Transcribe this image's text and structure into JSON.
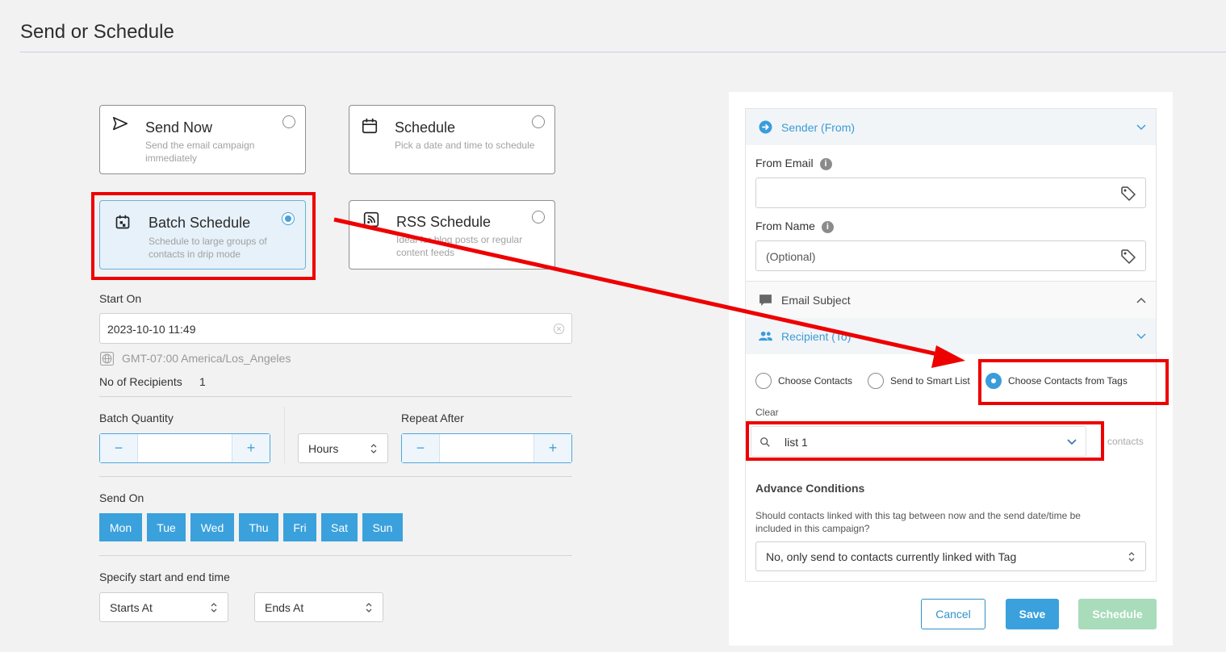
{
  "page": {
    "title": "Send or Schedule"
  },
  "options": [
    {
      "title": "Send Now",
      "subtitle_lines": [
        "Send the email campaign",
        "immediately"
      ],
      "icon": "paper-plane-icon",
      "selected": false
    },
    {
      "title": "Schedule",
      "subtitle_lines": [
        "Pick a date and time to schedule"
      ],
      "icon": "calendar-icon",
      "selected": false
    },
    {
      "title": "Batch Schedule",
      "subtitle_lines": [
        "Schedule to large groups of",
        "contacts in drip mode"
      ],
      "icon": "batch-calendar-icon",
      "selected": true
    },
    {
      "title": "RSS Schedule",
      "subtitle_lines": [
        "Ideal for blog posts or regular",
        "content feeds"
      ],
      "icon": "rss-icon",
      "selected": false
    }
  ],
  "batch": {
    "start_on_label": "Start On",
    "start_on_value": "2023-10-10 11:49",
    "timezone": "GMT-07:00 America/Los_Angeles",
    "recipients_label": "No of Recipients",
    "recipients_value": "1",
    "batch_quantity_label": "Batch Quantity",
    "minus": "−",
    "plus": "+",
    "unit_value": "Hours",
    "repeat_after_label": "Repeat After",
    "send_on_label": "Send On",
    "days": [
      "Mon",
      "Tue",
      "Wed",
      "Thu",
      "Fri",
      "Sat",
      "Sun"
    ],
    "time_range_label": "Specify start and end time",
    "starts_at": "Starts At",
    "ends_at": "Ends At"
  },
  "panel": {
    "sender_header": "Sender (From)",
    "from_email_label": "From Email",
    "from_email_value": "",
    "from_name_label": "From Name",
    "from_name_placeholder": "(Optional)",
    "info_glyph": "i",
    "subject_header": "Email Subject",
    "recipient_header": "Recipient (To)",
    "radio_options": [
      "Choose Contacts",
      "Send to Smart List",
      "Choose Contacts from Tags"
    ],
    "radio_selected": 2,
    "clear_label": "Clear",
    "tag_value": "list 1",
    "contacts_suffix": "contacts",
    "advance_title": "Advance Conditions",
    "advance_question_lines": [
      "Should contacts linked with this tag between now and the send date/time be",
      "included in this campaign?"
    ],
    "advance_value": "No, only send to contacts currently linked with Tag"
  },
  "actions": {
    "cancel": "Cancel",
    "save": "Save",
    "schedule": "Schedule"
  },
  "colors": {
    "accent": "#3aa1dc",
    "highlight": "#e00000",
    "disabled_green": "#a8dcba"
  }
}
